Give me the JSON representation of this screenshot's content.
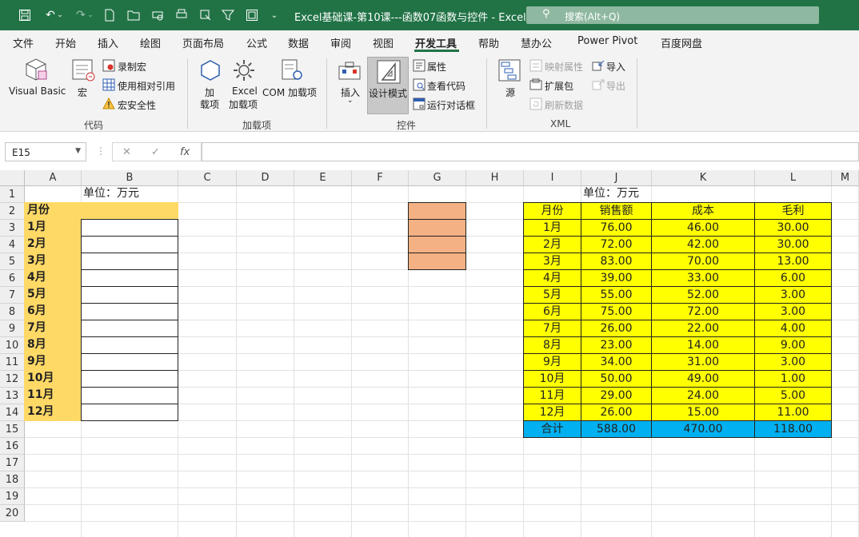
{
  "window": {
    "title": "Excel基础课-第10课---函数07函数与控件  -  Excel",
    "search_placeholder": "搜索(Alt+Q)"
  },
  "menu": [
    "文件",
    "开始",
    "插入",
    "绘图",
    "页面布局",
    "公式",
    "数据",
    "审阅",
    "视图",
    "开发工具",
    "帮助",
    "慧办公",
    "Power Pivot",
    "百度网盘"
  ],
  "ribbon": {
    "code": {
      "visual_basic": "Visual Basic",
      "macro": "宏",
      "record_macro": "录制宏",
      "relative_ref": "使用相对引用",
      "macro_security": "宏安全性",
      "group": "代码"
    },
    "addins": {
      "addin_line1": "加",
      "addin_line2": "载项",
      "excel_addin_line1": "Excel",
      "excel_addin_line2": "加载项",
      "com_addin": "COM 加载项",
      "group": "加载项"
    },
    "controls": {
      "insert": "插入",
      "design_mode": "设计模式",
      "properties": "属性",
      "view_code": "查看代码",
      "run_dialog": "运行对话框",
      "group": "控件"
    },
    "xml": {
      "source": "源",
      "map_properties": "映射属性",
      "expansion_packs": "扩展包",
      "refresh_data": "刷新数据",
      "import": "导入",
      "export": "导出",
      "group": "XML"
    }
  },
  "formula_bar": {
    "name_box": "E15",
    "formula": ""
  },
  "columns": [
    "A",
    "B",
    "C",
    "D",
    "E",
    "F",
    "G",
    "H",
    "I",
    "J",
    "K",
    "L",
    "M"
  ],
  "rows": [
    "1",
    "2",
    "3",
    "4",
    "5",
    "6",
    "7",
    "8",
    "9",
    "10",
    "11",
    "12",
    "13",
    "14",
    "15",
    "16",
    "17",
    "18",
    "19",
    "20"
  ],
  "left_table": {
    "unit": "单位：万元",
    "header": "月份",
    "months": [
      "1月",
      "2月",
      "3月",
      "4月",
      "5月",
      "6月",
      "7月",
      "8月",
      "9月",
      "10月",
      "11月",
      "12月"
    ]
  },
  "right_table": {
    "unit": "单位：万元",
    "headers": [
      "月份",
      "销售额",
      "成本",
      "毛利"
    ],
    "rows": [
      [
        "1月",
        "76.00",
        "46.00",
        "30.00"
      ],
      [
        "2月",
        "72.00",
        "42.00",
        "30.00"
      ],
      [
        "3月",
        "83.00",
        "70.00",
        "13.00"
      ],
      [
        "4月",
        "39.00",
        "33.00",
        "6.00"
      ],
      [
        "5月",
        "55.00",
        "52.00",
        "3.00"
      ],
      [
        "6月",
        "75.00",
        "72.00",
        "3.00"
      ],
      [
        "7月",
        "26.00",
        "22.00",
        "4.00"
      ],
      [
        "8月",
        "23.00",
        "14.00",
        "9.00"
      ],
      [
        "9月",
        "34.00",
        "31.00",
        "3.00"
      ],
      [
        "10月",
        "50.00",
        "49.00",
        "1.00"
      ],
      [
        "11月",
        "29.00",
        "24.00",
        "5.00"
      ],
      [
        "12月",
        "26.00",
        "15.00",
        "11.00"
      ]
    ],
    "total": [
      "合计",
      "588.00",
      "470.00",
      "118.00"
    ]
  },
  "colors": {
    "excel_green": "#217346",
    "header_orange": "#ffd966",
    "salmon": "#f4b183",
    "yellow": "#ffff00",
    "total_blue": "#00b0f0"
  }
}
